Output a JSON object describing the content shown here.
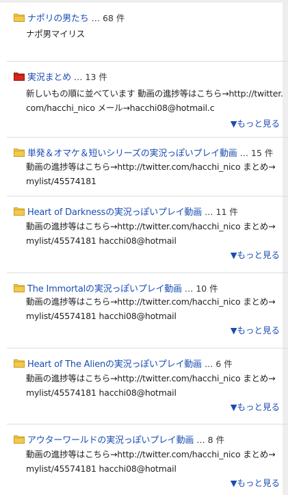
{
  "colors": {
    "link": "#1a4db3",
    "folder_yellow": "#f2c94c",
    "folder_red": "#d9261c",
    "divider": "#dddddd"
  },
  "more_label": "▼もっと見る",
  "items": [
    {
      "icon": "folder-yellow-icon",
      "title": "ナポリの男たち",
      "count": "… 68 件",
      "description": "ナポ男マイリス"
    },
    {
      "icon": "folder-red-icon",
      "title": "実況まとめ",
      "count": "… 13 件",
      "description": "新しいもの順に並べています 動画の進捗等はこちら→http://twitter.com/hacchi_nico メール→hacchi08@hotmail.c"
    },
    {
      "icon": "folder-yellow-icon",
      "title": "単発＆オマケ＆短いシリーズの実況っぽいプレイ動画",
      "count": "… 15 件",
      "description": "動画の進捗等はこちら→http://twitter.com/hacchi_nico まとめ→mylist/45574181"
    },
    {
      "icon": "folder-yellow-icon",
      "title": "Heart of Darknessの実況っぽいプレイ動画",
      "count": "… 11 件",
      "description": "動画の進捗等はこちら→http://twitter.com/hacchi_nico まとめ→mylist/45574181 hacchi08@hotmail"
    },
    {
      "icon": "folder-yellow-icon",
      "title": "The Immortalの実況っぽいプレイ動画",
      "count": "… 10 件",
      "description": "動画の進捗等はこちら→http://twitter.com/hacchi_nico まとめ→mylist/45574181 hacchi08@hotmail"
    },
    {
      "icon": "folder-yellow-icon",
      "title": "Heart of The Alienの実況っぽいプレイ動画",
      "count": "… 6 件",
      "description": "動画の進捗等はこちら→http://twitter.com/hacchi_nico まとめ→mylist/45574181 hacchi08@hotmail"
    },
    {
      "icon": "folder-yellow-icon",
      "title": "アウターワールドの実況っぽいプレイ動画",
      "count": "… 8 件",
      "description": "動画の進捗等はこちら→http://twitter.com/hacchi_nico まとめ→mylist/45574181 hacchi08@hotmail"
    }
  ]
}
